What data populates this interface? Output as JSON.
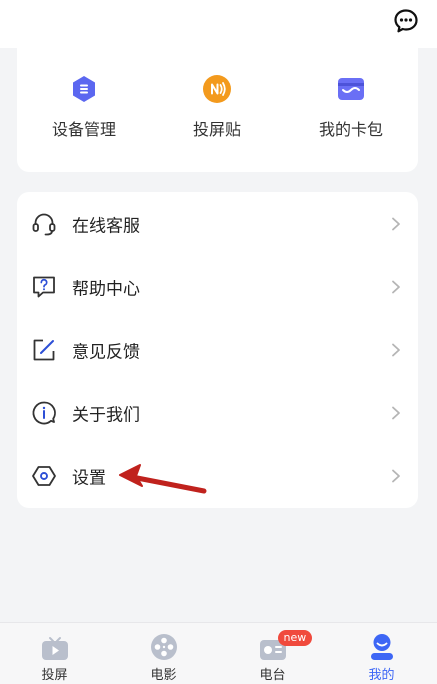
{
  "header": {
    "chat_icon": "chat-bubble-icon"
  },
  "quick_actions": [
    {
      "label": "设备管理",
      "icon": "device-hexagon-icon",
      "color": "#5b67f0"
    },
    {
      "label": "投屏贴",
      "icon": "nfc-sticker-icon",
      "color": "#f39a1d"
    },
    {
      "label": "我的卡包",
      "icon": "card-wallet-icon",
      "color": "#6a6ff5"
    }
  ],
  "menu": [
    {
      "label": "在线客服",
      "icon": "headset-icon"
    },
    {
      "label": "帮助中心",
      "icon": "help-question-icon"
    },
    {
      "label": "意见反馈",
      "icon": "feedback-edit-icon"
    },
    {
      "label": "关于我们",
      "icon": "info-icon"
    },
    {
      "label": "设置",
      "icon": "settings-hexagon-icon"
    }
  ],
  "annotation": {
    "arrow_color": "#c0221d"
  },
  "tabs": [
    {
      "label": "投屏",
      "icon": "cast-tv-icon",
      "active": false
    },
    {
      "label": "电影",
      "icon": "film-reel-icon",
      "active": false
    },
    {
      "label": "电台",
      "icon": "radio-icon",
      "active": false,
      "badge": "new"
    },
    {
      "label": "我的",
      "icon": "profile-icon",
      "active": true
    }
  ],
  "colors": {
    "accent": "#3d66f5",
    "badge": "#f04a3d",
    "tab_icon_inactive": "#b9bfcc"
  }
}
